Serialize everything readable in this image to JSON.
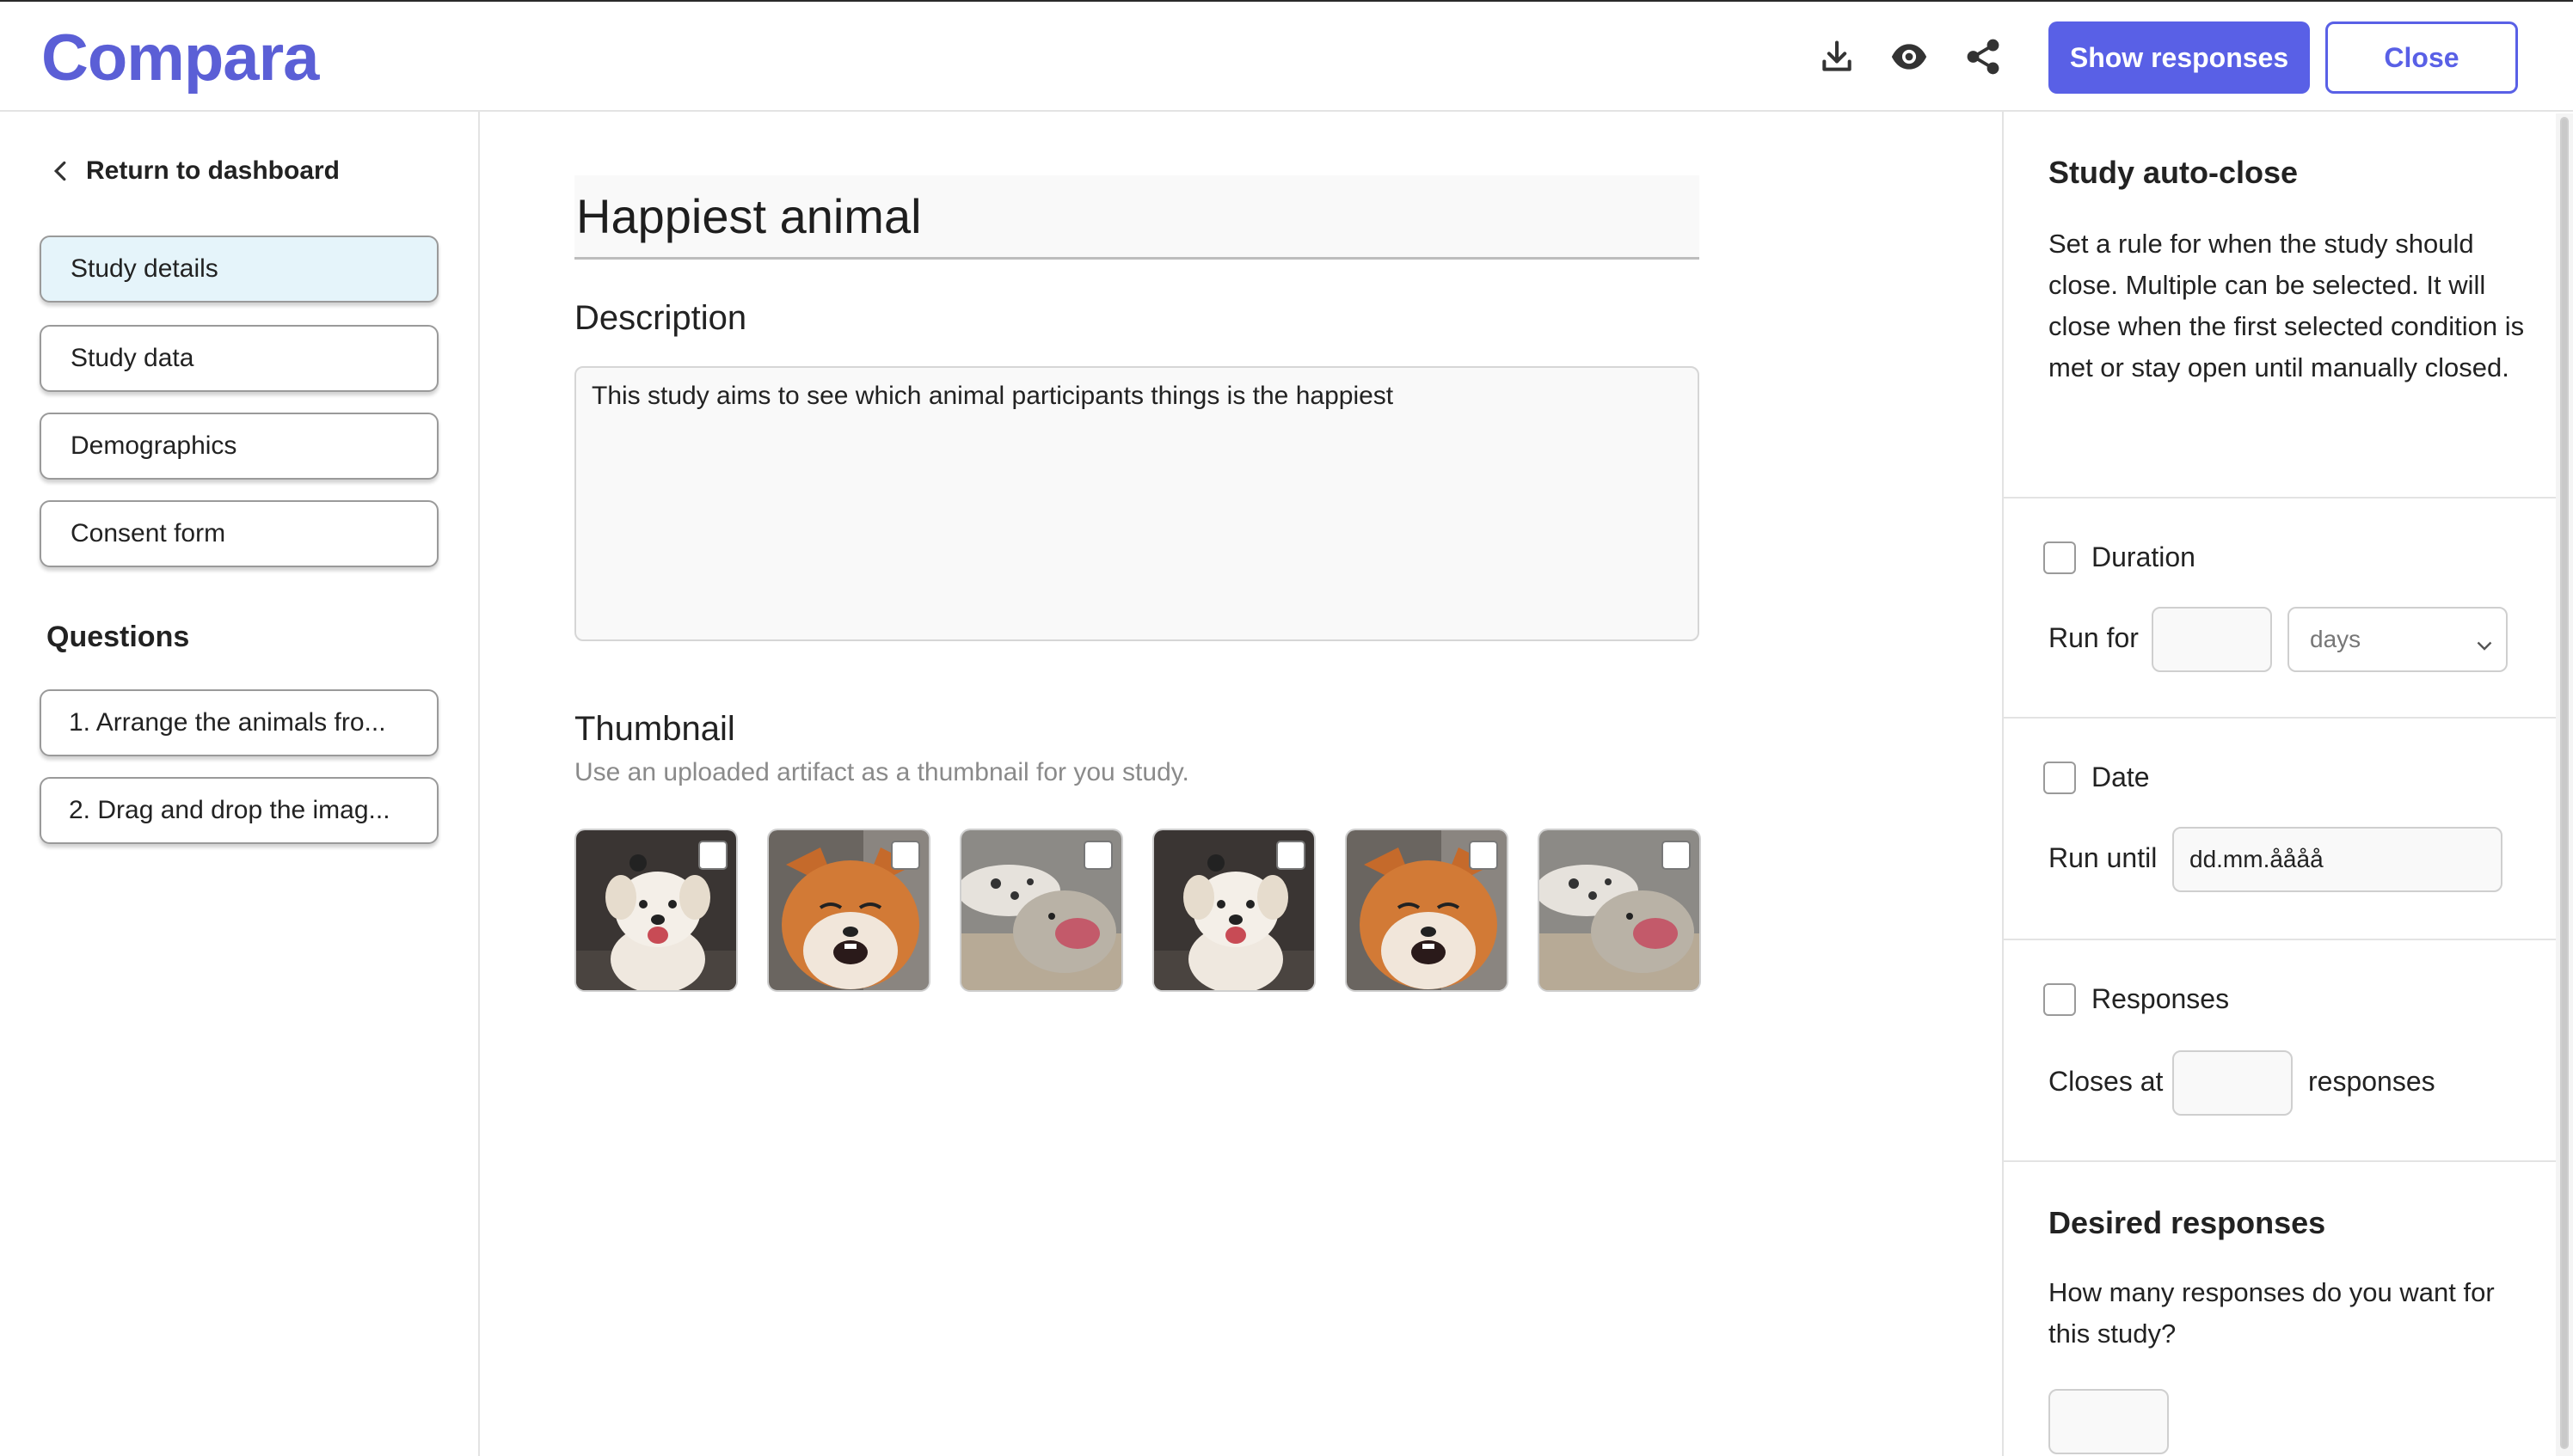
{
  "header": {
    "logo": "Compara",
    "icons": [
      "download-icon",
      "eye-icon",
      "share-icon"
    ],
    "show_responses_label": "Show responses",
    "close_label": "Close"
  },
  "sidebar": {
    "back_label": "Return to dashboard",
    "items": [
      {
        "label": "Study details",
        "active": true
      },
      {
        "label": "Study data",
        "active": false
      },
      {
        "label": "Demographics",
        "active": false
      },
      {
        "label": "Consent form",
        "active": false
      }
    ],
    "questions_heading": "Questions",
    "questions": [
      {
        "label": "1. Arrange the animals fro..."
      },
      {
        "label": "2. Drag and drop the imag..."
      }
    ]
  },
  "main": {
    "title": "Happiest animal",
    "description_label": "Description",
    "description_value": "This study aims to see which animal participants things is the happiest",
    "thumbnail_label": "Thumbnail",
    "thumbnail_hint": "Use an uploaded artifact as a thumbnail for you study.",
    "thumbnails": [
      "dog",
      "fox",
      "seal",
      "dog",
      "fox",
      "seal"
    ]
  },
  "right_panel": {
    "autoclose_title": "Study auto-close",
    "autoclose_text": "Set a rule for when the study should close. Multiple can be selected. It will close when the first selected condition is met or stay open until manually closed.",
    "duration": {
      "label": "Duration",
      "checked": false,
      "run_for_label": "Run for",
      "value": "",
      "unit": "days"
    },
    "date": {
      "label": "Date",
      "checked": false,
      "run_until_label": "Run until",
      "value": "dd.mm.åååå"
    },
    "responses": {
      "label": "Responses",
      "checked": false,
      "closes_at_label": "Closes at",
      "value": "",
      "suffix": "responses"
    },
    "desired_title": "Desired responses",
    "desired_text": "How many responses do you want for this study?",
    "desired_value": ""
  },
  "colors": {
    "accent": "#5960e6",
    "logo": "#5b5fd6",
    "active_nav": "#e5f4fa"
  }
}
